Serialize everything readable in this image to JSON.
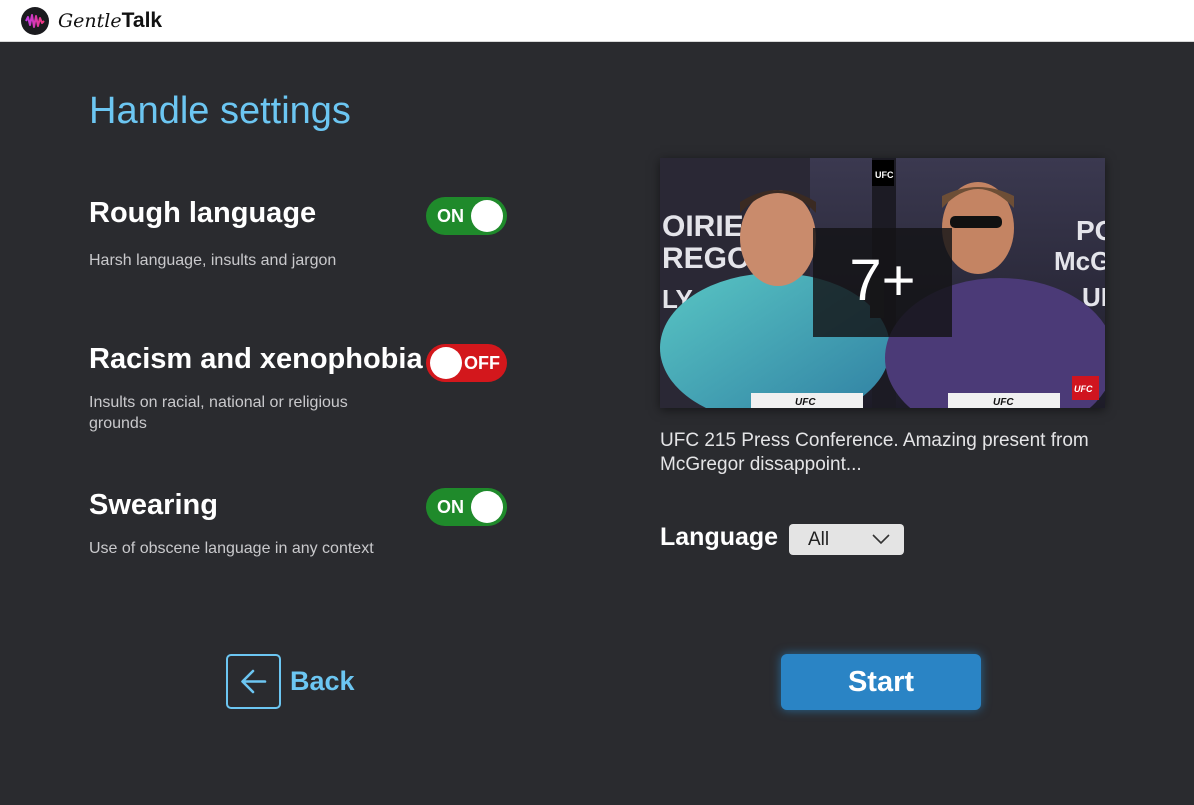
{
  "app": {
    "logo_gentle": "Gentle",
    "logo_talk": "Talk"
  },
  "page": {
    "title": "Handle settings"
  },
  "settings": [
    {
      "title": "Rough language",
      "description": "Harsh language, insults and jargon",
      "state": "ON"
    },
    {
      "title": "Racism and xenophobia",
      "description": "Insults on racial, national or religious grounds",
      "state": "OFF"
    },
    {
      "title": "Swearing",
      "description": "Use of obscene language in any context",
      "state": "ON"
    }
  ],
  "video": {
    "age_rating": "7+",
    "caption": "UFC 215 Press Conference. Amazing present from McGregor dissappoint...",
    "brand_tag": "UFC"
  },
  "language": {
    "label": "Language",
    "selected": "All"
  },
  "buttons": {
    "back": "Back",
    "start": "Start"
  },
  "colors": {
    "background": "#2a2b2f",
    "accent": "#6cc6f2",
    "toggle_on": "#1f8a2b",
    "toggle_off": "#d3171c",
    "primary_button": "#2a84c5"
  },
  "icons": {
    "logo": "waveform-logo-icon",
    "back": "arrow-left-icon",
    "dropdown": "chevron-down-icon"
  }
}
